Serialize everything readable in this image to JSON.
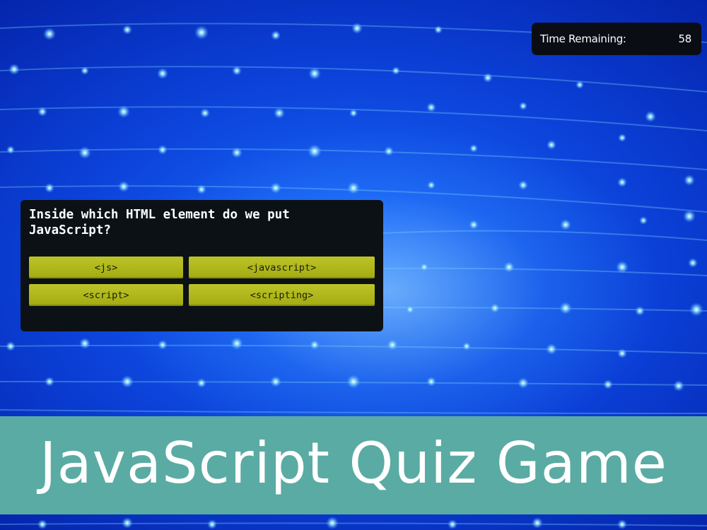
{
  "timer": {
    "label": "Time Remaining:",
    "value": "58"
  },
  "quiz": {
    "question": "Inside which HTML element do we put JavaScript?",
    "answers": [
      "<js>",
      "<javascript>",
      "<script>",
      "<scripting>"
    ]
  },
  "banner": {
    "title": "JavaScript Quiz Game"
  },
  "colors": {
    "background": "#0b3fd6",
    "panel": "#0c1116",
    "answer_button": "#b2ba1f",
    "banner": "#5aaba3"
  }
}
